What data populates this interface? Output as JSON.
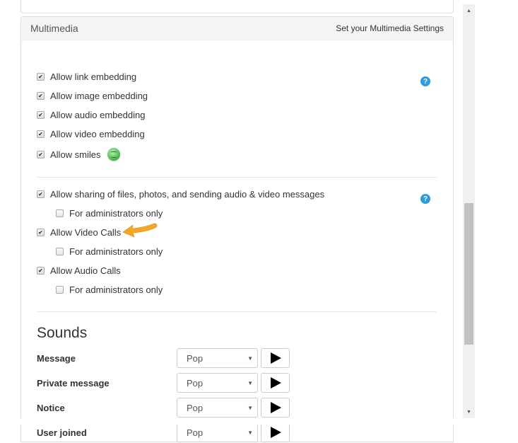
{
  "panel": {
    "title": "Multimedia",
    "subtitle": "Set your Multimedia Settings"
  },
  "embedding": {
    "help_icon": "?",
    "items": [
      {
        "label": "Allow link embedding",
        "checked": true
      },
      {
        "label": "Allow image embedding",
        "checked": true
      },
      {
        "label": "Allow audio embedding",
        "checked": true
      },
      {
        "label": "Allow video embedding",
        "checked": true
      },
      {
        "label": "Allow smiles",
        "checked": true
      }
    ]
  },
  "sharing": {
    "help_icon": "?",
    "items": [
      {
        "label": "Allow sharing of files, photos, and sending audio & video messages",
        "checked": true
      },
      {
        "label": "For administrators only",
        "checked": false
      },
      {
        "label": "Allow Video Calls",
        "checked": true
      },
      {
        "label": "For administrators only",
        "checked": false
      },
      {
        "label": "Allow Audio Calls",
        "checked": true
      },
      {
        "label": "For administrators only",
        "checked": false
      }
    ]
  },
  "sounds": {
    "title": "Sounds",
    "rows": [
      {
        "label": "Message",
        "value": "Pop"
      },
      {
        "label": "Private message",
        "value": "Pop"
      },
      {
        "label": "Notice",
        "value": "Pop"
      },
      {
        "label": "User joined",
        "value": "Pop"
      }
    ]
  },
  "glyphs": {
    "check": "✔",
    "caret": "▼",
    "scroll_up": "▲",
    "scroll_down": "▼"
  },
  "colors": {
    "help_icon": "#2d9be0",
    "annotation_arrow": "#f5a623"
  }
}
